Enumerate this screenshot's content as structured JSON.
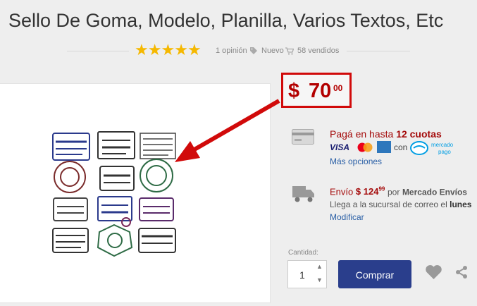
{
  "product": {
    "title": "Sello De Goma, Modelo, Planilla, Varios Textos, Etc",
    "rating_stars": 5,
    "opinions": "1 opinión",
    "condition": "Nuevo",
    "sold": "58 vendidos"
  },
  "price": {
    "currency": "$",
    "integer": "70",
    "cents": "00"
  },
  "payment": {
    "text_prefix": "Pagá en hasta",
    "installments": "12 cuotas",
    "logos": [
      "VISA",
      "mastercard",
      "amex"
    ],
    "con": "con",
    "provider": "mercado pago",
    "more_options": "Más opciones"
  },
  "shipping": {
    "prefix": "Envío",
    "currency": "$",
    "integer": "124",
    "cents": "99",
    "por": "por",
    "carrier": "Mercado Envíos",
    "arrives_prefix": "Llega a la sucursal de correo el",
    "arrives_day": "lunes",
    "modify": "Modificar"
  },
  "purchase": {
    "quantity_label": "Cantidad:",
    "quantity_value": "1",
    "buy_label": "Comprar"
  },
  "icons": [
    "star-icon",
    "tag-icon",
    "cart-icon",
    "credit-card-icon",
    "handshake-icon",
    "truck-icon",
    "heart-icon",
    "share-icon",
    "arrow-annotation"
  ],
  "colors": {
    "price_red": "#b30000",
    "annotation_red": "#d10a0a",
    "star": "#f5b800",
    "buy_button": "#2a3e8c",
    "link": "#2a5fa6"
  }
}
